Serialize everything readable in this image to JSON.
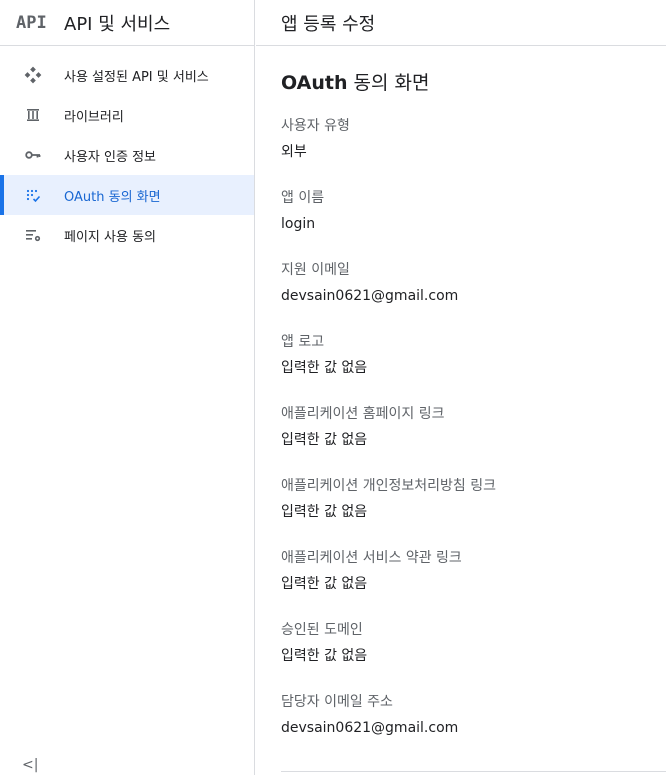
{
  "sidebar": {
    "brand_logo": "API",
    "brand_title": "API 및 서비스",
    "items": [
      {
        "label": "사용 설정된 API 및 서비스",
        "icon": "diamond-dots-icon"
      },
      {
        "label": "라이브러리",
        "icon": "library-icon"
      },
      {
        "label": "사용자 인증 정보",
        "icon": "key-icon"
      },
      {
        "label": "OAuth 동의 화면",
        "icon": "oauth-dots-icon",
        "active": true
      },
      {
        "label": "페이지 사용 동의",
        "icon": "settings-list-icon"
      }
    ],
    "collapse_label": "<|"
  },
  "main": {
    "page_title": "앱 등록 수정",
    "section_title_strong": "OAuth",
    "section_title_rest": " 동의 화면",
    "fields": [
      {
        "label": "사용자 유형",
        "value": "외부"
      },
      {
        "label": "앱 이름",
        "value": "login"
      },
      {
        "label": "지원 이메일",
        "value": "devsain0621@gmail.com"
      },
      {
        "label": "앱 로고",
        "value": "입력한 값 없음"
      },
      {
        "label": "애플리케이션 홈페이지 링크",
        "value": "입력한 값 없음"
      },
      {
        "label": "애플리케이션 개인정보처리방침 링크",
        "value": "입력한 값 없음"
      },
      {
        "label": "애플리케이션 서비스 약관 링크",
        "value": "입력한 값 없음"
      },
      {
        "label": "승인된 도메인",
        "value": "입력한 값 없음"
      },
      {
        "label": "담당자 이메일 주소",
        "value": "devsain0621@gmail.com"
      }
    ]
  },
  "colors": {
    "accent": "#1a73e8",
    "active_bg": "#e8f0fe",
    "label_gray": "#5f6368",
    "text": "#202124",
    "divider": "#dadce0"
  }
}
